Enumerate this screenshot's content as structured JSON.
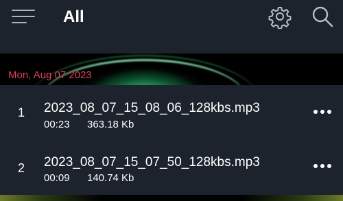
{
  "header": {
    "title": "All",
    "menu_icon": "hamburger-menu-icon",
    "settings_icon": "gear-icon",
    "search_icon": "search-icon"
  },
  "banner": {
    "date_label": "Mon, Aug 07 2023",
    "date_color": "#e0405a"
  },
  "recordings": [
    {
      "index": "1",
      "filename": "2023_08_07_15_08_06_128kbs.mp3",
      "duration": "00:23",
      "size": "363.18 Kb"
    },
    {
      "index": "2",
      "filename": "2023_08_07_15_07_50_128kbs.mp3",
      "duration": "00:09",
      "size": "140.74 Kb"
    }
  ],
  "colors": {
    "background": "#1c232d",
    "accent_glow": "#50e68c"
  }
}
